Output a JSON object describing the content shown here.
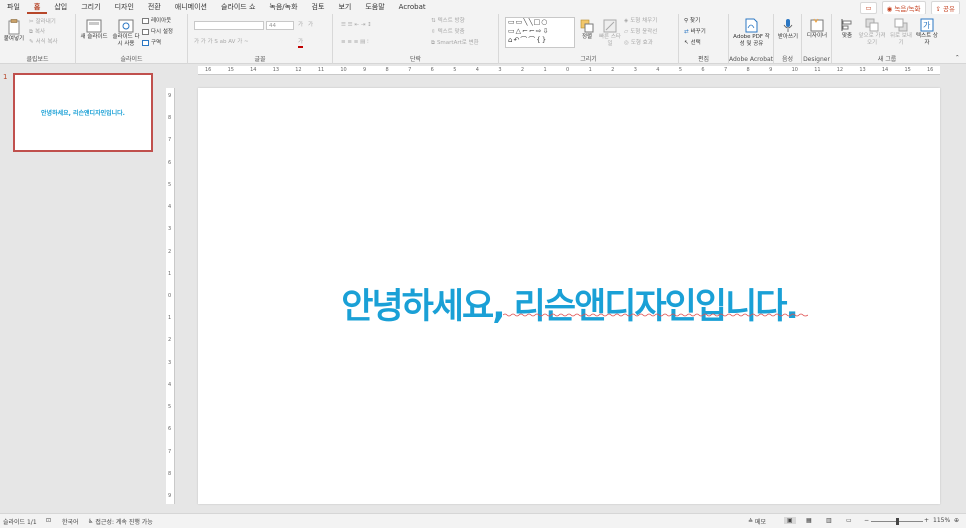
{
  "tabs": [
    "파일",
    "홈",
    "삽입",
    "그리기",
    "디자인",
    "전환",
    "애니메이션",
    "슬라이드 쇼",
    "녹음/녹화",
    "검토",
    "보기",
    "도움말",
    "Acrobat"
  ],
  "active_tab": "홈",
  "tab_right": {
    "record": "녹음/녹화",
    "share": "공유"
  },
  "ribbon": {
    "clipboard": {
      "label": "클립보드",
      "paste": "붙여넣기",
      "cut": "잘라내기",
      "copy": "복사",
      "format_painter": "서식 복사"
    },
    "slides": {
      "label": "슬라이드",
      "new_slide": "새 슬라이드",
      "reuse_slide": "슬라이드 다시 사용",
      "layout": "레이아웃",
      "reset": "다시 설정",
      "section": "구역"
    },
    "font": {
      "label": "글꼴",
      "size_placeholder": "44",
      "grow": "가",
      "shrink": "가",
      "styles": "가 가 가 S ab AV 가 ~"
    },
    "paragraph": {
      "label": "단락",
      "text_direction": "텍스트 방향",
      "align_text": "텍스트 맞춤",
      "smartart": "SmartArt로 변환"
    },
    "drawing": {
      "label": "그리기",
      "arrange": "정렬",
      "quick_styles": "빠른 스타일",
      "shape_fill": "도형 채우기",
      "shape_outline": "도형 윤곽선",
      "shape_effects": "도형 효과",
      "shapes_gallery": "▭▭╲╲□○\n▭△⌐⌐⇨⇩\n⌂↶⌒⌒{}"
    },
    "editing": {
      "label": "편집",
      "find": "찾기",
      "replace": "바꾸기",
      "select": "선택"
    },
    "acrobat": {
      "label": "Adobe Acrobat",
      "create_pdf": "Adobe PDF 작성 및 공유"
    },
    "voice": {
      "label": "음성",
      "dictate": "받아쓰기"
    },
    "designer": {
      "label": "Designer",
      "designer": "디자이너"
    },
    "new_group": {
      "label": "새 그룹",
      "align": "맞춤",
      "bring_forward": "앞으로 가져오기",
      "send_backward": "뒤로 보내기",
      "textbox": "텍스트 상자"
    }
  },
  "thumbnail": {
    "number": "1",
    "text": "안녕하세요, 리슨앤디자인입니다."
  },
  "hruler": [
    "16",
    "15",
    "14",
    "13",
    "12",
    "11",
    "10",
    "9",
    "8",
    "7",
    "6",
    "5",
    "4",
    "3",
    "2",
    "1",
    "0",
    "1",
    "2",
    "3",
    "4",
    "5",
    "6",
    "7",
    "8",
    "9",
    "10",
    "11",
    "12",
    "13",
    "14",
    "15",
    "16"
  ],
  "vruler": [
    "9",
    "8",
    "7",
    "6",
    "5",
    "4",
    "3",
    "2",
    "1",
    "0",
    "1",
    "2",
    "3",
    "4",
    "5",
    "6",
    "7",
    "8",
    "9"
  ],
  "slide": {
    "text": "안녕하세요, 리슨앤디자인입니다.",
    "text_color": "#1aa0d6"
  },
  "status": {
    "slide_count": "슬라이드 1/1",
    "language": "한국어",
    "accessibility": "접근성: 계속 진행 가능",
    "notes": "메모",
    "zoom": "115%"
  },
  "colors": {
    "accent": "#b7472a",
    "slide_text": "#1aa0d6"
  }
}
